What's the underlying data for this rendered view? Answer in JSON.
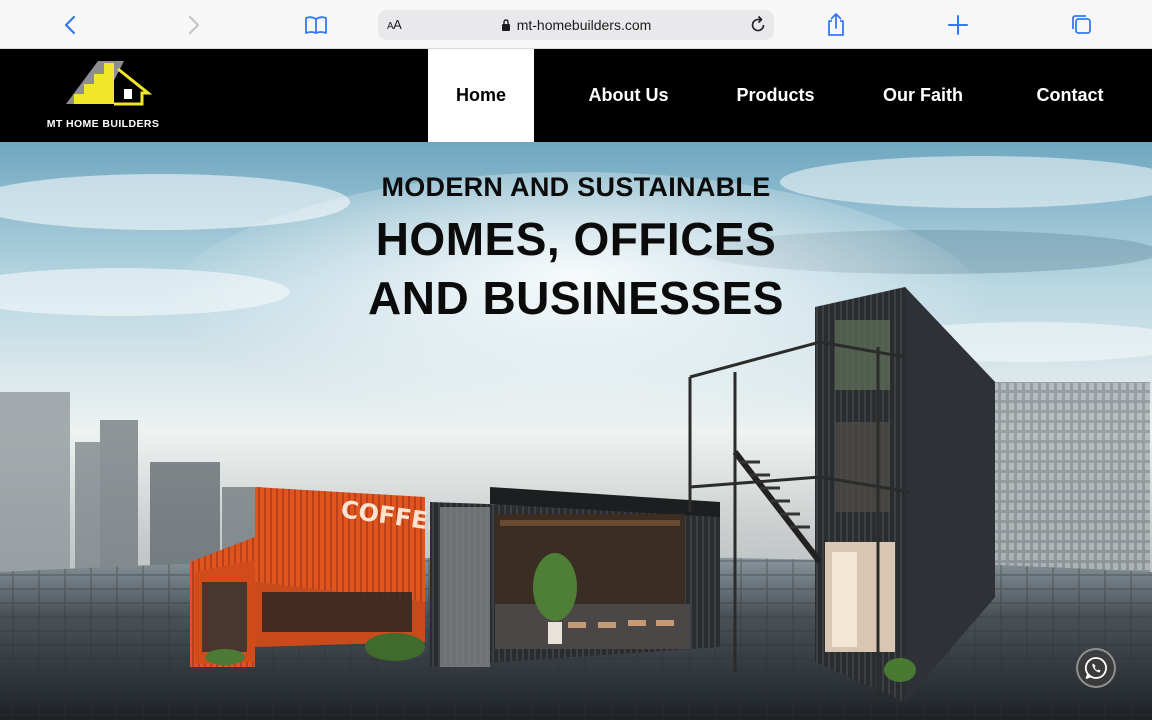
{
  "browser": {
    "url_display": "mt-homebuilders.com",
    "text_size_label": "AA",
    "icons": [
      "back-chevron-icon",
      "forward-chevron-icon",
      "bookmarks-book-icon",
      "lock-icon",
      "reload-icon",
      "share-icon",
      "new-tab-plus-icon",
      "tabs-overview-icon"
    ],
    "accent_color": "#3478f6"
  },
  "site": {
    "logo_text": "MT HOME BUILDERS",
    "nav": [
      {
        "label": "Home",
        "active": true
      },
      {
        "label": "About Us",
        "active": false
      },
      {
        "label": "Products",
        "active": false
      },
      {
        "label": "Our Faith",
        "active": false
      },
      {
        "label": "Contact",
        "active": false
      }
    ],
    "nav_bg": "#000000",
    "logo_accent": "#f2e62a"
  },
  "hero": {
    "subtitle": "MODERN AND SUSTAINABLE",
    "title_line1": "HOMES, OFFICES",
    "title_line2": "AND BUSINESSES",
    "container_sign": "COFFEE",
    "chat_icon": "whatsapp-icon"
  }
}
